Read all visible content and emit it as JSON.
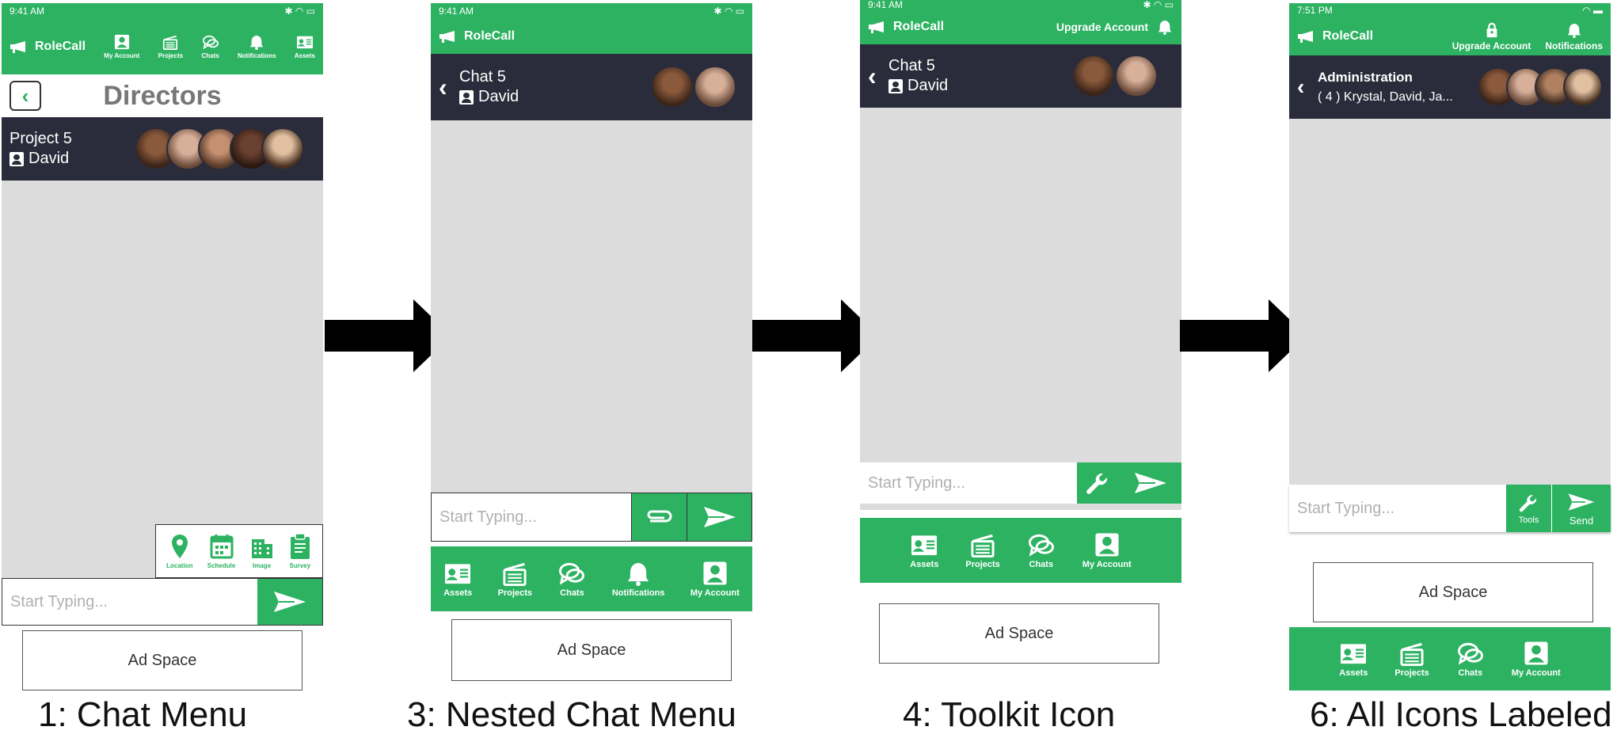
{
  "colors": {
    "green": "#2db262",
    "dark": "#2b2c3b",
    "chat_bg": "#dcdcdc",
    "arrow": "#000000"
  },
  "screen1": {
    "time": "9:41 AM",
    "brand": "RoleCall",
    "nav": [
      "My Account",
      "Projects",
      "Chats",
      "Notifications",
      "Assets"
    ],
    "page_title": "Directors",
    "chat_title": "Project 5",
    "chat_user": "David",
    "tools": [
      "Location",
      "Schedule",
      "Image",
      "Survey"
    ],
    "input_placeholder": "Start Typing...",
    "ad": "Ad Space",
    "caption": "1: Chat Menu"
  },
  "screen3": {
    "time": "9:41 AM",
    "brand": "RoleCall",
    "chat_title": "Chat 5",
    "chat_user": "David",
    "input_placeholder": "Start Typing...",
    "nav": [
      "Assets",
      "Projects",
      "Chats",
      "Notifications",
      "My Account"
    ],
    "ad": "Ad Space",
    "caption": "3: Nested Chat Menu"
  },
  "screen4": {
    "time": "9:41 AM",
    "brand": "RoleCall",
    "upgrade": "Upgrade Account",
    "chat_title": "Chat 5",
    "chat_user": "David",
    "input_placeholder": "Start Typing...",
    "nav": [
      "Assets",
      "Projects",
      "Chats",
      "My Account"
    ],
    "ad": "Ad Space",
    "caption": "4: Toolkit Icon"
  },
  "screen6": {
    "time": "7:51 PM",
    "brand": "RoleCall",
    "upgrade": "Upgrade Account",
    "notifications": "Notifications",
    "chat_title": "Administration",
    "chat_members": "( 4 ) Krystal, David, Ja...",
    "input_placeholder": "Start Typing...",
    "tools_label": "Tools",
    "send_label": "Send",
    "ad": "Ad Space",
    "nav": [
      "Assets",
      "Projects",
      "Chats",
      "My Account"
    ],
    "caption": "6: All Icons Labeled"
  },
  "icons": [
    "megaphone-icon",
    "account-icon",
    "projects-icon",
    "chats-icon",
    "bell-icon",
    "assets-icon",
    "send-icon",
    "paperclip-icon",
    "wrench-icon",
    "lock-icon",
    "location-icon",
    "calendar-icon",
    "building-icon",
    "clipboard-icon",
    "back-chevron-icon",
    "arrow-right-icon"
  ]
}
